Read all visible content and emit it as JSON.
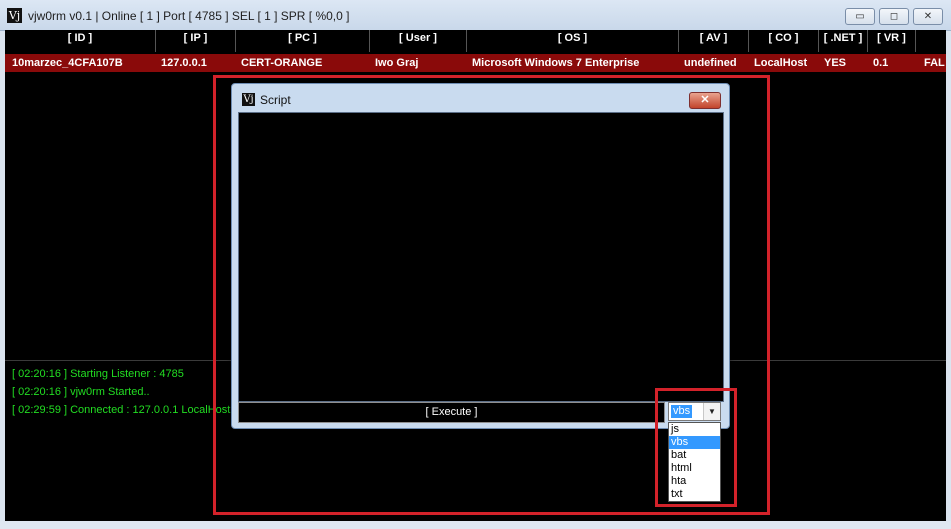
{
  "window": {
    "logo": "Vj",
    "title": "vjw0rm v0.1 | Online [ 1 ] Port [ 4785 ] SEL [ 1 ] SPR [ %0,0 ]",
    "minimize": "▭",
    "maximize": "◻",
    "close": "✕"
  },
  "table": {
    "columns": [
      "[ ID ]",
      "[ IP ]",
      "[ PC ]",
      "[ User ]",
      "[ OS ]",
      "[ AV ]",
      "[ CO ]",
      "[ .NET ]",
      "[ VR ]"
    ],
    "rows": [
      {
        "id": "10marzec_4CFA107B",
        "ip": "127.0.0.1",
        "pc": "CERT-ORANGE",
        "user": "Iwo Graj",
        "os": "Microsoft Windows 7 Enterprise",
        "av": "undefined",
        "co": "LocalHost",
        "net": "YES",
        "vr": "0.1",
        "extra": "FAL"
      }
    ]
  },
  "log": [
    "[ 02:20:16 ] Starting Listener : 4785",
    "[ 02:20:16 ] vjw0rm Started..",
    "[ 02:29:59 ] Connected : 127.0.0.1 LocalHost"
  ],
  "dialog": {
    "logo": "Vj",
    "title": "Script",
    "close": "✕",
    "execute_label": "[ Execute ]",
    "selected_type": "vbs",
    "options": [
      "js",
      "vbs",
      "bat",
      "html",
      "hta",
      "txt"
    ]
  },
  "colors": {
    "row_highlight": "#8a0a0a",
    "log_text": "#22dd22",
    "annotation": "#d3222a",
    "selection": "#3399ff"
  }
}
